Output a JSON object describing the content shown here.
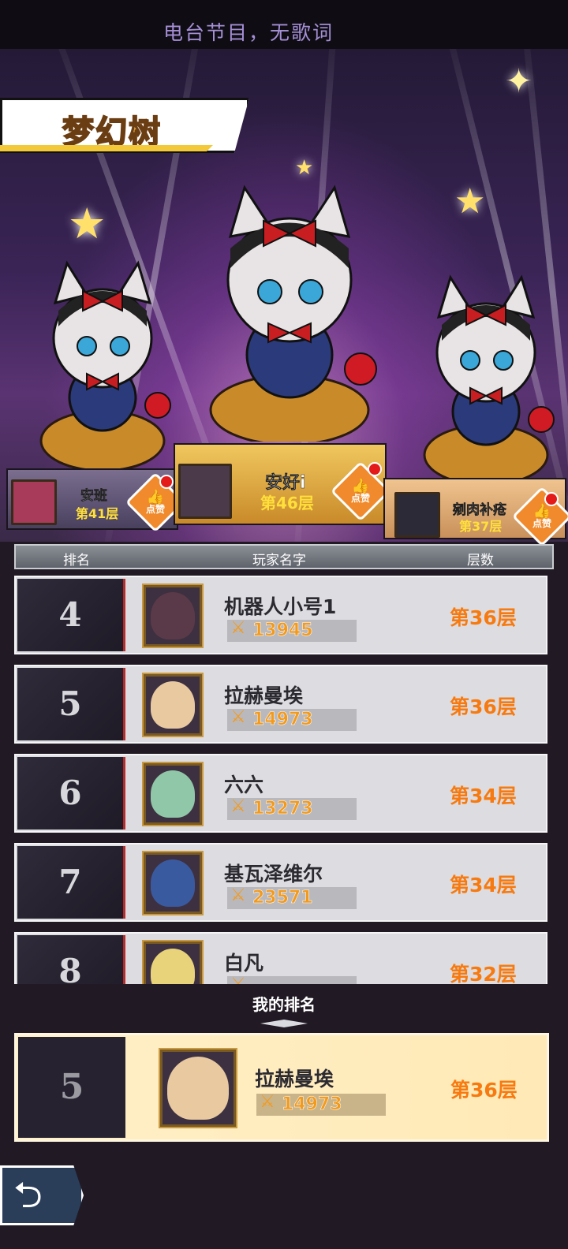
{
  "top_bar": {
    "subtitle_text": "电台节目，无歌词"
  },
  "stage": {
    "title": "梦幻树"
  },
  "podium": {
    "first": {
      "name": "安好i",
      "floor": "第46层",
      "like_label": "点赞"
    },
    "second": {
      "name": "安班",
      "floor": "第41层",
      "like_label": "点赞"
    },
    "third": {
      "name": "剜肉补疮",
      "floor": "第37层",
      "like_label": "点赞"
    }
  },
  "table_header": {
    "rank": "排名",
    "player_name": "玩家名字",
    "floor": "层数"
  },
  "rows": [
    {
      "rank": "4",
      "name": "机器人小号1",
      "power": "13945",
      "floor": "第36层"
    },
    {
      "rank": "5",
      "name": "拉赫曼埃",
      "power": "14973",
      "floor": "第36层"
    },
    {
      "rank": "6",
      "name": "六六",
      "power": "13273",
      "floor": "第34层"
    },
    {
      "rank": "7",
      "name": "基瓦泽维尔",
      "power": "23571",
      "floor": "第34层"
    },
    {
      "rank": "8",
      "name": "白凡",
      "power": "",
      "floor": "第32层"
    }
  ],
  "my_rank": {
    "title": "我的排名",
    "rank": "5",
    "name": "拉赫曼埃",
    "power": "14973",
    "floor": "第36层"
  },
  "colors": {
    "accent_orange": "#f77a10",
    "like_orange": "#f08a2c",
    "gold": "#ffe03a"
  },
  "icons": {
    "back": "back-arrow-icon",
    "like": "thumbs-up-icon",
    "power": "crossed-swords-icon"
  }
}
